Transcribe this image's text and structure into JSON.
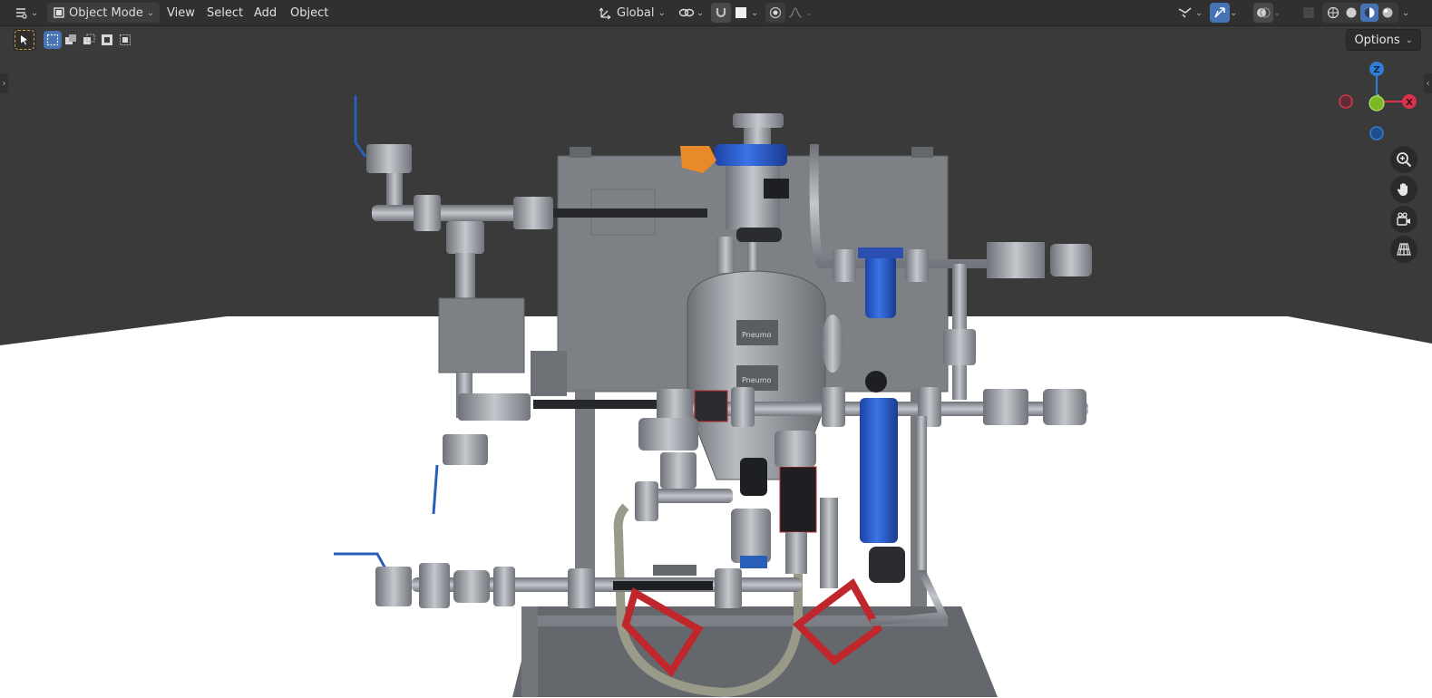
{
  "header": {
    "mode": {
      "label": "Object Mode",
      "icon": "object-mode-icon"
    },
    "menus": [
      "View",
      "Select",
      "Add",
      "Object"
    ],
    "transform_orientation": {
      "label": "Global",
      "icon": "transform-orientation-icon"
    },
    "options_label": "Options"
  },
  "tools": {
    "select_tool_icon": "cursor-select-icon",
    "select_modes": [
      "select-box-new-icon",
      "select-extend-icon",
      "select-subtract-icon",
      "select-difference-icon",
      "select-intersect-icon"
    ]
  },
  "gizmo": {
    "axes": [
      {
        "label": "Z",
        "color": "#2f7fd8"
      },
      {
        "label": "X",
        "color": "#d8334a"
      },
      {
        "label": "Y",
        "color": "#7ab828"
      }
    ]
  },
  "navigation": [
    "zoom-icon",
    "pan-hand-icon",
    "camera-view-icon",
    "perspective-grid-icon"
  ],
  "colors": {
    "accent": "#4772b3",
    "viewport_bg": "#3a3a3a",
    "floor": "#ffffff",
    "metal": "#8e9298",
    "filter_blue": "#2c5fd1",
    "support_red": "#c0272d"
  },
  "viewport": {
    "watermark_labels": [
      "Pneumo",
      "Pneumo"
    ]
  }
}
